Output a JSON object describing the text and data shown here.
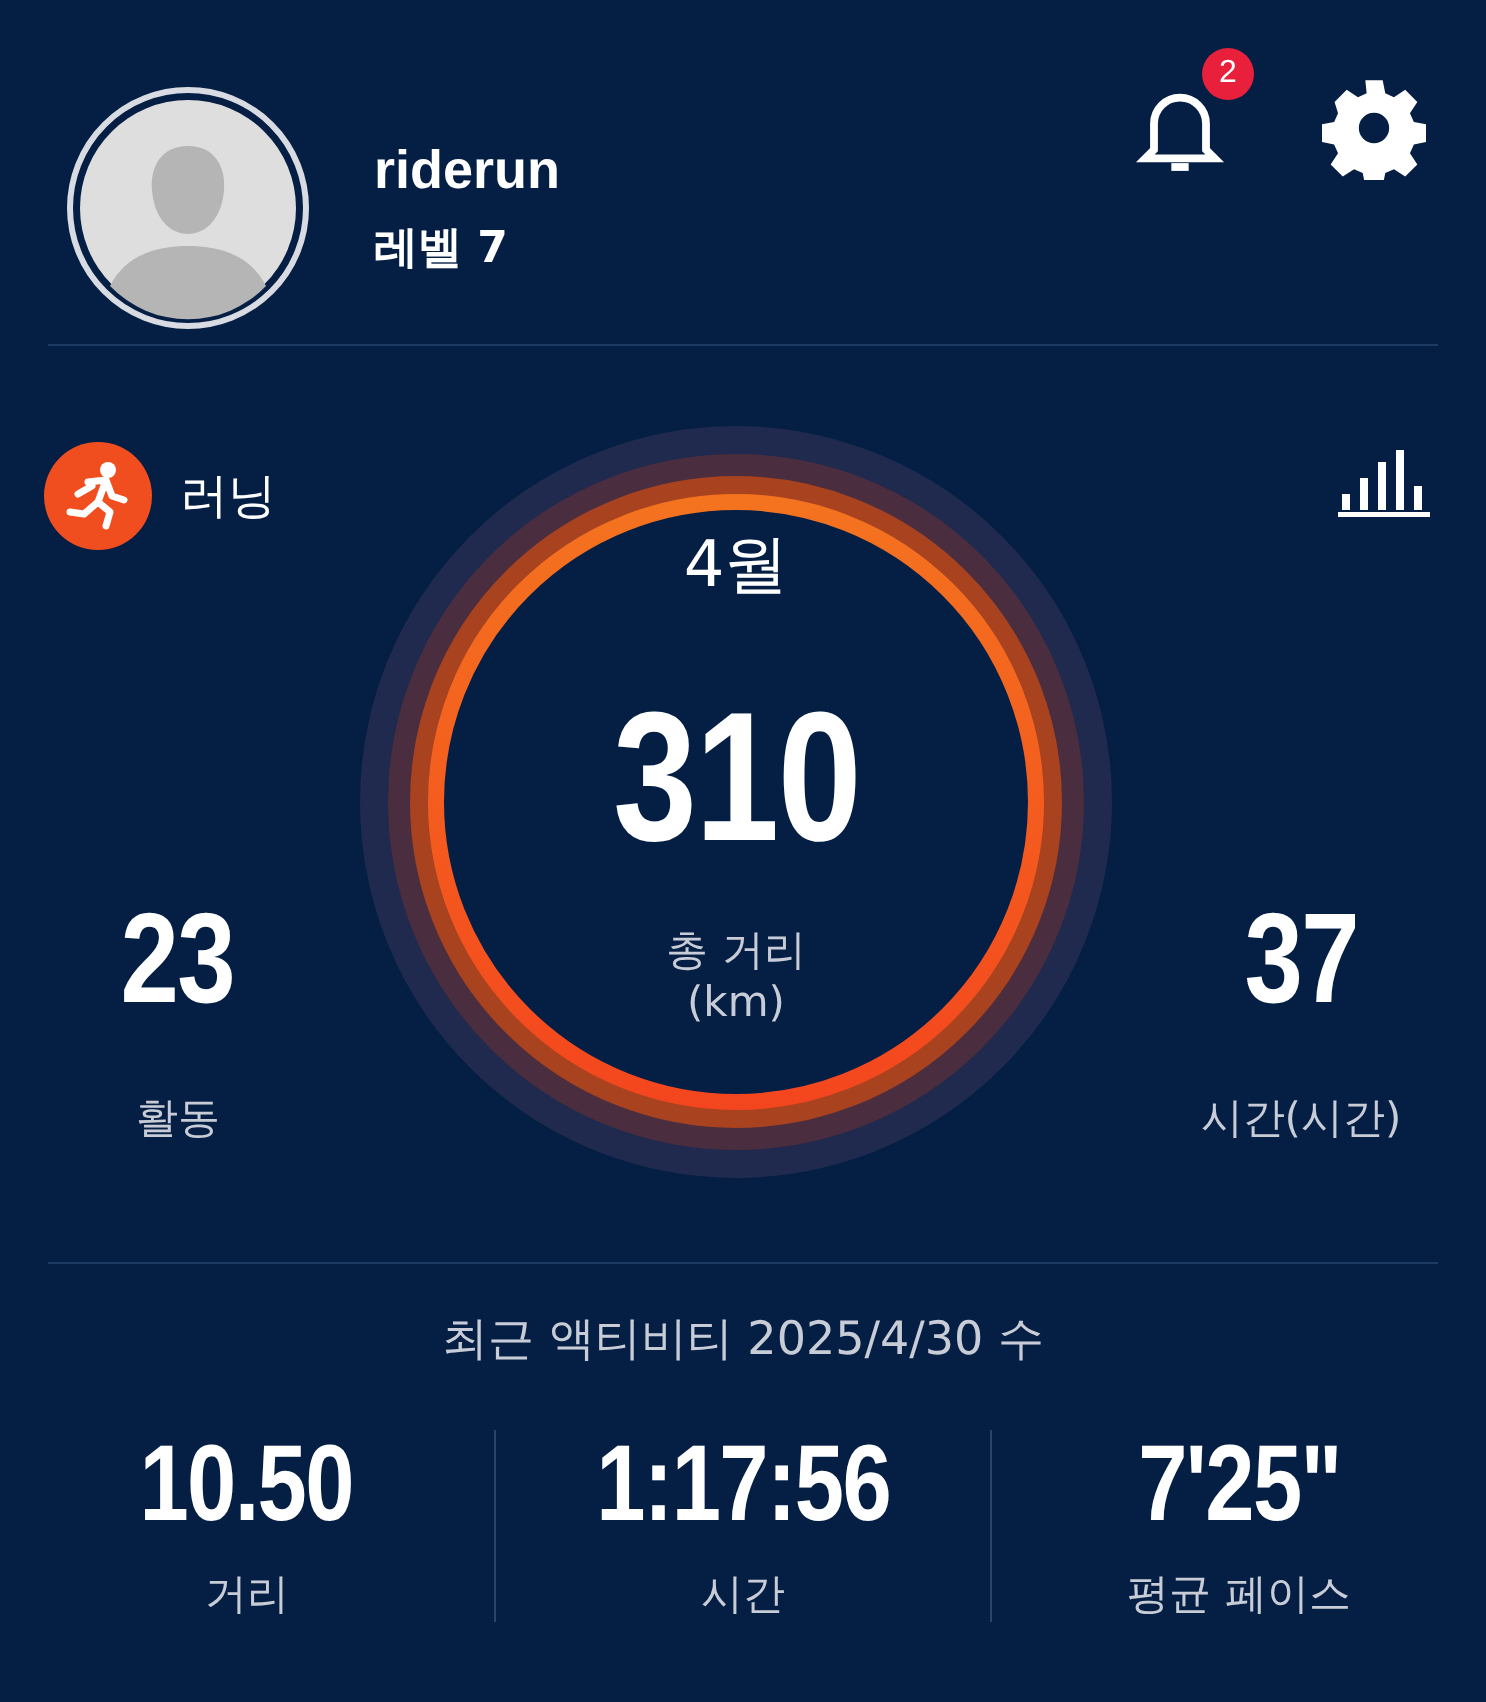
{
  "profile": {
    "username": "riderun",
    "level": "레벨 7"
  },
  "notifications": {
    "count": "2"
  },
  "sport": {
    "label": "러닝"
  },
  "summary": {
    "month": "4월",
    "total": "310",
    "total_label": "총 거리",
    "total_unit": "(km)",
    "left": {
      "value": "23",
      "label": "활동"
    },
    "right": {
      "value": "37",
      "label": "시간(시간)"
    }
  },
  "recent": {
    "title": "최근 액티비티 2025/4/30 수",
    "stats": [
      {
        "value": "10.50",
        "label": "거리"
      },
      {
        "value": "1:17:56",
        "label": "시간"
      },
      {
        "value": "7'25\"",
        "label": "평균 페이스"
      }
    ]
  }
}
